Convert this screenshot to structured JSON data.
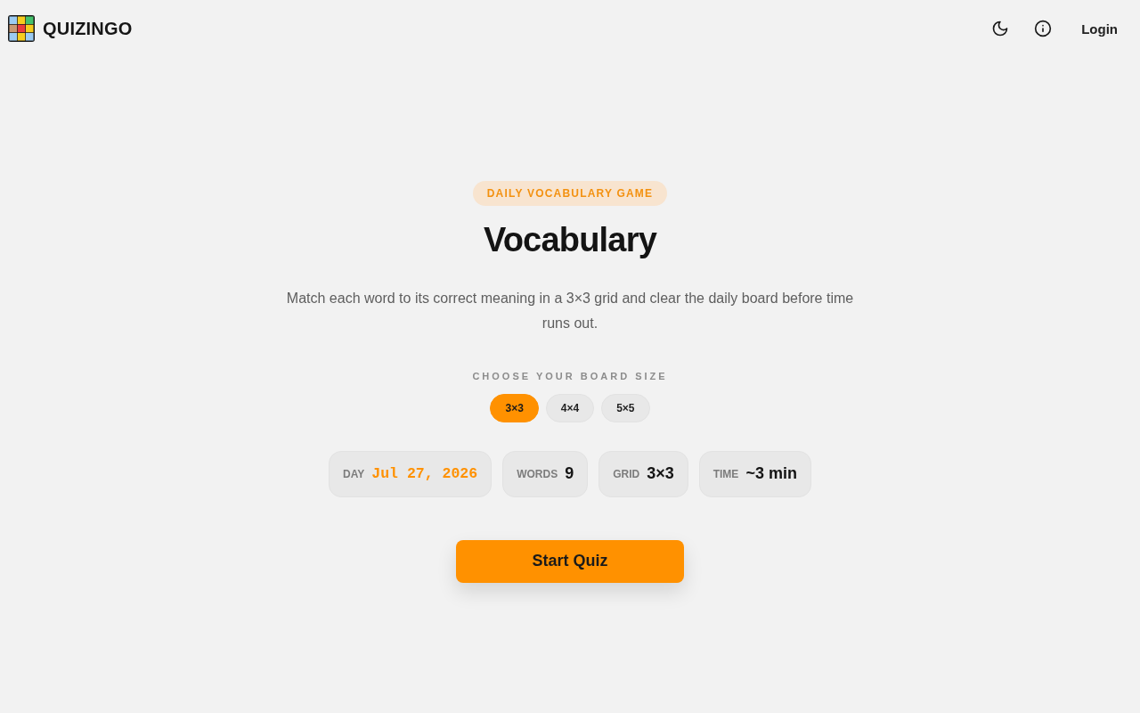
{
  "header": {
    "brand": "QUIZINGO",
    "login": "Login"
  },
  "hero": {
    "badge": "DAILY VOCABULARY GAME",
    "title": "Vocabulary",
    "description": "Match each word to its correct meaning in a 3×3 grid and clear the daily board before time runs out."
  },
  "board_size": {
    "label": "CHOOSE YOUR BOARD SIZE",
    "options": [
      {
        "label": "3×3",
        "selected": true
      },
      {
        "label": "4×4",
        "selected": false
      },
      {
        "label": "5×5",
        "selected": false
      }
    ]
  },
  "stats": [
    {
      "kind": "date",
      "label": "DAY",
      "value": "Jul 27, 2026"
    },
    {
      "kind": "plain",
      "label": "WORDS",
      "value": "9"
    },
    {
      "kind": "plain",
      "label": "GRID",
      "value": "3×3"
    },
    {
      "kind": "plain",
      "label": "TIME",
      "value": "~3 min"
    }
  ],
  "start_button": "Start Quiz"
}
